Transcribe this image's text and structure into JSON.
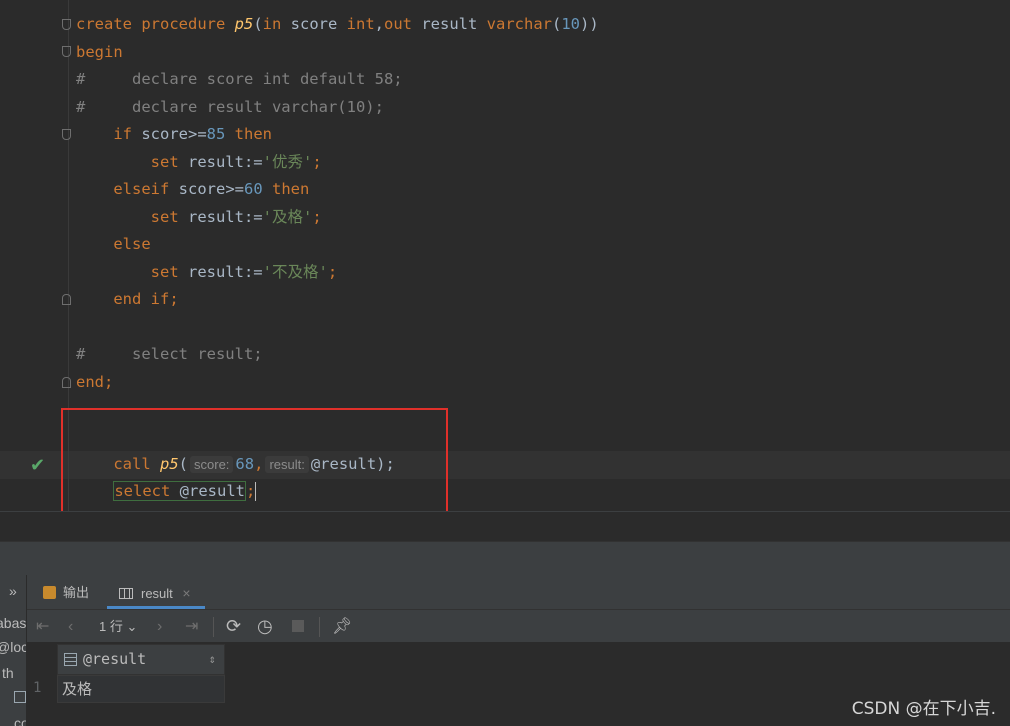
{
  "editor": {
    "lines": [
      {
        "t": [
          [
            "kw",
            "create procedure "
          ],
          [
            "fn",
            "p5"
          ],
          [
            "plain",
            "("
          ],
          [
            "kw",
            "in "
          ],
          [
            "plain",
            "score "
          ],
          [
            "kw",
            "int"
          ],
          [
            "plain",
            ","
          ],
          [
            "kw",
            "out "
          ],
          [
            "plain",
            "result "
          ],
          [
            "kw",
            "varchar"
          ],
          [
            "plain",
            "("
          ],
          [
            "num",
            "10"
          ],
          [
            "plain",
            "))"
          ]
        ]
      },
      {
        "t": [
          [
            "kw",
            "begin"
          ]
        ]
      },
      {
        "t": [
          [
            "cmt",
            "#     declare score int default 58;"
          ]
        ]
      },
      {
        "t": [
          [
            "cmt",
            "#     declare result varchar(10);"
          ]
        ]
      },
      {
        "t": [
          [
            "plain",
            "    "
          ],
          [
            "kw",
            "if "
          ],
          [
            "plain",
            "score>="
          ],
          [
            "num",
            "85 "
          ],
          [
            "kw",
            "then"
          ]
        ]
      },
      {
        "t": [
          [
            "plain",
            "        "
          ],
          [
            "kw",
            "set "
          ],
          [
            "plain",
            "result:="
          ],
          [
            "str",
            "'优秀'"
          ],
          [
            "kw",
            ";"
          ]
        ]
      },
      {
        "t": [
          [
            "plain",
            "    "
          ],
          [
            "kw",
            "elseif "
          ],
          [
            "plain",
            "score>="
          ],
          [
            "num",
            "60 "
          ],
          [
            "kw",
            "then"
          ]
        ]
      },
      {
        "t": [
          [
            "plain",
            "        "
          ],
          [
            "kw",
            "set "
          ],
          [
            "plain",
            "result:="
          ],
          [
            "str",
            "'及格'"
          ],
          [
            "kw",
            ";"
          ]
        ]
      },
      {
        "t": [
          [
            "plain",
            "    "
          ],
          [
            "kw",
            "else"
          ]
        ]
      },
      {
        "t": [
          [
            "plain",
            "        "
          ],
          [
            "kw",
            "set "
          ],
          [
            "plain",
            "result:="
          ],
          [
            "str",
            "'不及格'"
          ],
          [
            "kw",
            ";"
          ]
        ]
      },
      {
        "t": [
          [
            "plain",
            "    "
          ],
          [
            "kw",
            "end if"
          ],
          [
            "kw",
            ";"
          ]
        ]
      },
      {
        "t": []
      },
      {
        "t": [
          [
            "cmt",
            "#     select result;"
          ]
        ]
      },
      {
        "t": [
          [
            "kw",
            "end"
          ],
          [
            "kw",
            ";"
          ]
        ]
      },
      {
        "t": []
      }
    ],
    "call_line": {
      "call_kw": "call ",
      "fn": "p5",
      "open": "(",
      "hint_score": "score:",
      "score_val": "68",
      "comma": ",",
      "hint_result": "result:",
      "result_arg": "@result",
      "close": ");"
    },
    "select_line": {
      "select_kw": "select ",
      "var": "@result",
      "semi": ";"
    }
  },
  "left_strip": [
    "»",
    "abas",
    "@loc",
    "th",
    "",
    "co"
  ],
  "tabs": [
    {
      "label": "输出",
      "icon": "output-icon"
    },
    {
      "label": "result",
      "icon": "table-icon",
      "close": "×"
    }
  ],
  "toolbar": {
    "rows_label": "1 行 ⌄"
  },
  "grid": {
    "column": "@result",
    "sort_glyph": "⇕",
    "rows": [
      {
        "num": "1",
        "value": "及格"
      }
    ]
  },
  "watermark": "CSDN @在下小吉."
}
